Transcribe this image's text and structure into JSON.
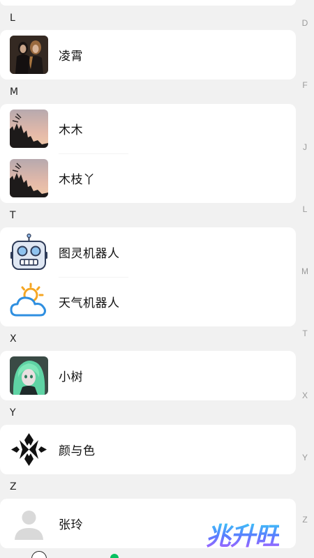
{
  "sections": [
    {
      "letter": "L",
      "contacts": [
        {
          "name": "凌霄",
          "avatar": "couple-photo-avatar"
        }
      ]
    },
    {
      "letter": "M",
      "contacts": [
        {
          "name": "木木",
          "avatar": "sunset-tree-avatar"
        },
        {
          "name": "木枝丫",
          "avatar": "sunset-tree-avatar"
        }
      ]
    },
    {
      "letter": "T",
      "contacts": [
        {
          "name": "图灵机器人",
          "avatar": "robot-icon"
        },
        {
          "name": "天气机器人",
          "avatar": "weather-cloud-sun-icon"
        }
      ]
    },
    {
      "letter": "X",
      "contacts": [
        {
          "name": "小树",
          "avatar": "anime-girl-avatar"
        }
      ]
    },
    {
      "letter": "Y",
      "contacts": [
        {
          "name": "颜与色",
          "avatar": "black-emblem-logo"
        }
      ]
    },
    {
      "letter": "Z",
      "contacts": [
        {
          "name": "张玲",
          "avatar": "default-person-avatar"
        }
      ]
    }
  ],
  "index_letters": [
    "D",
    "F",
    "J",
    "L",
    "M",
    "T",
    "X",
    "Y",
    "Z"
  ],
  "watermark": "兆升旺",
  "colors": {
    "background": "#f1f1f1",
    "card": "#ffffff",
    "index_text": "#9a9a9a",
    "active_tab": "#07c160"
  }
}
